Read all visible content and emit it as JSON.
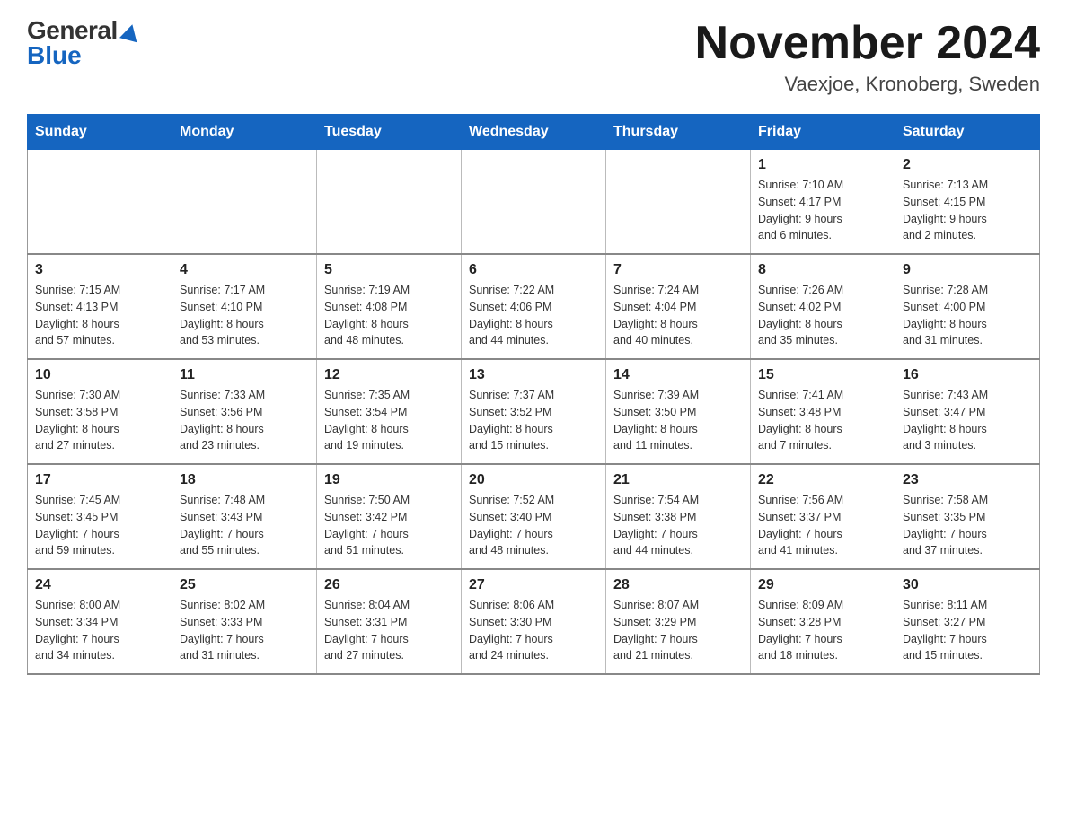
{
  "header": {
    "logo_general": "General",
    "logo_blue": "Blue",
    "month_title": "November 2024",
    "location": "Vaexjoe, Kronoberg, Sweden"
  },
  "weekdays": [
    "Sunday",
    "Monday",
    "Tuesday",
    "Wednesday",
    "Thursday",
    "Friday",
    "Saturday"
  ],
  "weeks": [
    [
      {
        "day": "",
        "info": ""
      },
      {
        "day": "",
        "info": ""
      },
      {
        "day": "",
        "info": ""
      },
      {
        "day": "",
        "info": ""
      },
      {
        "day": "",
        "info": ""
      },
      {
        "day": "1",
        "info": "Sunrise: 7:10 AM\nSunset: 4:17 PM\nDaylight: 9 hours\nand 6 minutes."
      },
      {
        "day": "2",
        "info": "Sunrise: 7:13 AM\nSunset: 4:15 PM\nDaylight: 9 hours\nand 2 minutes."
      }
    ],
    [
      {
        "day": "3",
        "info": "Sunrise: 7:15 AM\nSunset: 4:13 PM\nDaylight: 8 hours\nand 57 minutes."
      },
      {
        "day": "4",
        "info": "Sunrise: 7:17 AM\nSunset: 4:10 PM\nDaylight: 8 hours\nand 53 minutes."
      },
      {
        "day": "5",
        "info": "Sunrise: 7:19 AM\nSunset: 4:08 PM\nDaylight: 8 hours\nand 48 minutes."
      },
      {
        "day": "6",
        "info": "Sunrise: 7:22 AM\nSunset: 4:06 PM\nDaylight: 8 hours\nand 44 minutes."
      },
      {
        "day": "7",
        "info": "Sunrise: 7:24 AM\nSunset: 4:04 PM\nDaylight: 8 hours\nand 40 minutes."
      },
      {
        "day": "8",
        "info": "Sunrise: 7:26 AM\nSunset: 4:02 PM\nDaylight: 8 hours\nand 35 minutes."
      },
      {
        "day": "9",
        "info": "Sunrise: 7:28 AM\nSunset: 4:00 PM\nDaylight: 8 hours\nand 31 minutes."
      }
    ],
    [
      {
        "day": "10",
        "info": "Sunrise: 7:30 AM\nSunset: 3:58 PM\nDaylight: 8 hours\nand 27 minutes."
      },
      {
        "day": "11",
        "info": "Sunrise: 7:33 AM\nSunset: 3:56 PM\nDaylight: 8 hours\nand 23 minutes."
      },
      {
        "day": "12",
        "info": "Sunrise: 7:35 AM\nSunset: 3:54 PM\nDaylight: 8 hours\nand 19 minutes."
      },
      {
        "day": "13",
        "info": "Sunrise: 7:37 AM\nSunset: 3:52 PM\nDaylight: 8 hours\nand 15 minutes."
      },
      {
        "day": "14",
        "info": "Sunrise: 7:39 AM\nSunset: 3:50 PM\nDaylight: 8 hours\nand 11 minutes."
      },
      {
        "day": "15",
        "info": "Sunrise: 7:41 AM\nSunset: 3:48 PM\nDaylight: 8 hours\nand 7 minutes."
      },
      {
        "day": "16",
        "info": "Sunrise: 7:43 AM\nSunset: 3:47 PM\nDaylight: 8 hours\nand 3 minutes."
      }
    ],
    [
      {
        "day": "17",
        "info": "Sunrise: 7:45 AM\nSunset: 3:45 PM\nDaylight: 7 hours\nand 59 minutes."
      },
      {
        "day": "18",
        "info": "Sunrise: 7:48 AM\nSunset: 3:43 PM\nDaylight: 7 hours\nand 55 minutes."
      },
      {
        "day": "19",
        "info": "Sunrise: 7:50 AM\nSunset: 3:42 PM\nDaylight: 7 hours\nand 51 minutes."
      },
      {
        "day": "20",
        "info": "Sunrise: 7:52 AM\nSunset: 3:40 PM\nDaylight: 7 hours\nand 48 minutes."
      },
      {
        "day": "21",
        "info": "Sunrise: 7:54 AM\nSunset: 3:38 PM\nDaylight: 7 hours\nand 44 minutes."
      },
      {
        "day": "22",
        "info": "Sunrise: 7:56 AM\nSunset: 3:37 PM\nDaylight: 7 hours\nand 41 minutes."
      },
      {
        "day": "23",
        "info": "Sunrise: 7:58 AM\nSunset: 3:35 PM\nDaylight: 7 hours\nand 37 minutes."
      }
    ],
    [
      {
        "day": "24",
        "info": "Sunrise: 8:00 AM\nSunset: 3:34 PM\nDaylight: 7 hours\nand 34 minutes."
      },
      {
        "day": "25",
        "info": "Sunrise: 8:02 AM\nSunset: 3:33 PM\nDaylight: 7 hours\nand 31 minutes."
      },
      {
        "day": "26",
        "info": "Sunrise: 8:04 AM\nSunset: 3:31 PM\nDaylight: 7 hours\nand 27 minutes."
      },
      {
        "day": "27",
        "info": "Sunrise: 8:06 AM\nSunset: 3:30 PM\nDaylight: 7 hours\nand 24 minutes."
      },
      {
        "day": "28",
        "info": "Sunrise: 8:07 AM\nSunset: 3:29 PM\nDaylight: 7 hours\nand 21 minutes."
      },
      {
        "day": "29",
        "info": "Sunrise: 8:09 AM\nSunset: 3:28 PM\nDaylight: 7 hours\nand 18 minutes."
      },
      {
        "day": "30",
        "info": "Sunrise: 8:11 AM\nSunset: 3:27 PM\nDaylight: 7 hours\nand 15 minutes."
      }
    ]
  ]
}
